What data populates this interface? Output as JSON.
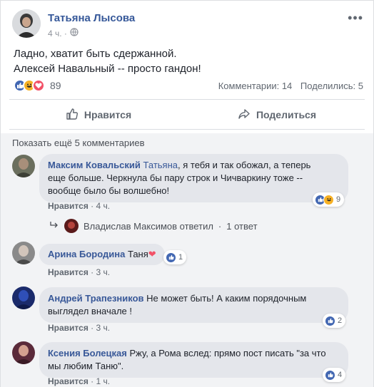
{
  "post": {
    "author": "Татьяна Лысова",
    "time": "4 ч. ·",
    "text_line1": "Ладно, хватит быть сдержанной.",
    "text_line2": "Алексей Навальный -- просто гандон!",
    "reaction_count": "89",
    "comments_stat": "Комментарии: 14",
    "shares_stat": "Поделились: 5",
    "like_label": "Нравится",
    "share_label": "Поделиться",
    "reaction_icons": [
      "like-icon",
      "haha-icon",
      "love-icon"
    ]
  },
  "comments_section": {
    "show_more": "Показать ещё 5 комментариев",
    "like_label": "Нравится",
    "comments": [
      {
        "author": "Максим Ковальский",
        "tag": "Татьяна",
        "text_line1": ", я тебя и так обожал, а теперь",
        "text_line2": "еще больше. Черкнула бы пару строк и Чичваркину тоже --",
        "text_line3": "вообще было бы волшебно!",
        "time": "4 ч.",
        "reactions": "9",
        "reply_author": "Владислав Максимов ответил",
        "reply_count": "1 ответ"
      },
      {
        "author": "Арина Бородина",
        "text": "Таня",
        "time": "3 ч.",
        "reactions": "1"
      },
      {
        "author": "Андрей Трапезников",
        "text_line1": "Не может быть! А каким порядочным",
        "text_line2": "выглядел вначале !",
        "time": "3 ч.",
        "reactions": "2"
      },
      {
        "author": "Ксения Болецкая",
        "text_line1": "Ржу, а Рома вслед: прямо пост писать \"за что",
        "text_line2": "мы любим Таню\".",
        "time": "1 ч.",
        "reactions": "4"
      }
    ]
  },
  "colors": {
    "link": "#385898",
    "like_blue": "#4267b2",
    "love_red": "#f25268",
    "haha_yellow": "#f7b125"
  }
}
